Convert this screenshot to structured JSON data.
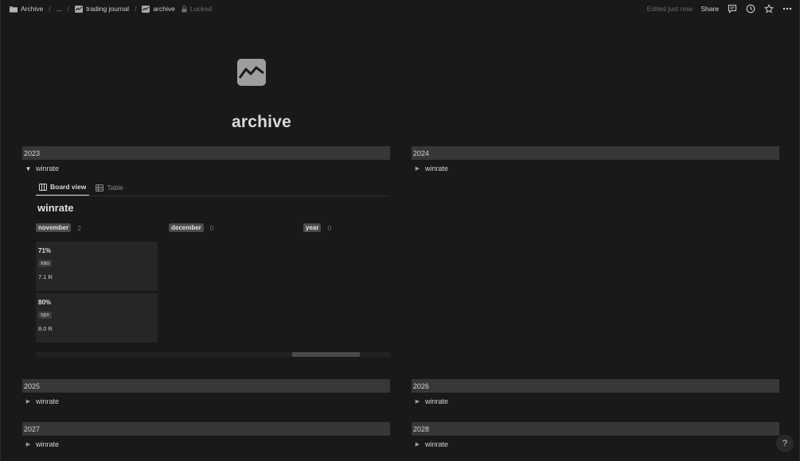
{
  "breadcrumb": {
    "items": [
      {
        "label": "Archive",
        "icon": "folder-icon"
      },
      {
        "label": "..."
      },
      {
        "label": "trading journal",
        "icon": "chart-page-icon"
      },
      {
        "label": "archive",
        "icon": "chart-page-icon"
      }
    ],
    "separator": "/",
    "lock_label": "Locked"
  },
  "topbar": {
    "edited": "Edited just now",
    "share_label": "Share"
  },
  "page": {
    "title": "archive",
    "icon": "chart-page-icon"
  },
  "sections": {
    "y2023": {
      "year": "2023",
      "toggle": "winrate",
      "expanded": true
    },
    "y2024": {
      "year": "2024",
      "toggle": "winrate",
      "expanded": false
    },
    "y2025": {
      "year": "2025",
      "toggle": "winrate",
      "expanded": false
    },
    "y2026": {
      "year": "2026",
      "toggle": "winrate",
      "expanded": false
    },
    "y2027": {
      "year": "2027",
      "toggle": "winrate",
      "expanded": false
    },
    "y2028": {
      "year": "2028",
      "toggle": "winrate",
      "expanded": false
    }
  },
  "database": {
    "tabs": [
      {
        "label": "Board view",
        "active": true
      },
      {
        "label": "Table",
        "active": false
      }
    ],
    "title": "winrate",
    "groups": [
      {
        "name": "november",
        "count": "2"
      },
      {
        "name": "december",
        "count": "0"
      },
      {
        "name": "year",
        "count": "0"
      }
    ],
    "cards": [
      {
        "pct": "71%",
        "tag": "xau",
        "r": "7.1 R"
      },
      {
        "pct": "80%",
        "tag": "spx",
        "r": "8.0 R"
      }
    ]
  },
  "help": "?",
  "colors": {
    "background": "#191919",
    "year_bar": "#373737",
    "card": "#262626"
  }
}
